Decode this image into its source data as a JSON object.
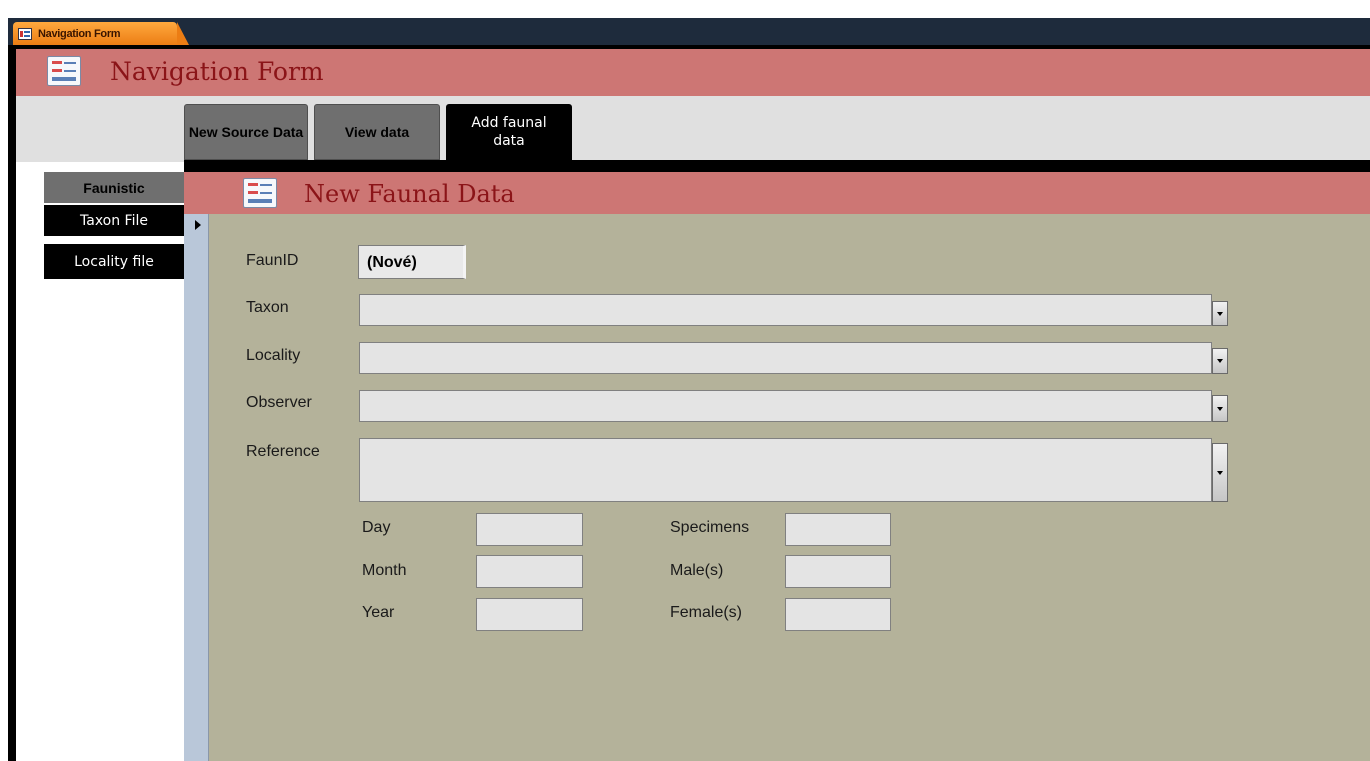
{
  "document_tab": {
    "label": "Navigation Form"
  },
  "header": {
    "title": "Navigation Form"
  },
  "top_tabs": [
    {
      "label": "New Source Data"
    },
    {
      "label": "View data"
    },
    {
      "label": "Add faunal data",
      "active": true
    }
  ],
  "side_nav": [
    {
      "label": "Faunistic",
      "active": true
    },
    {
      "label": "Taxon File"
    },
    {
      "label": "Locality file"
    }
  ],
  "form": {
    "title": "New Faunal Data",
    "faunid_label": "FaunID",
    "faunid_value": "(Nové)",
    "taxon_label": "Taxon",
    "locality_label": "Locality",
    "observer_label": "Observer",
    "reference_label": "Reference",
    "day_label": "Day",
    "month_label": "Month",
    "year_label": "Year",
    "specimens_label": "Specimens",
    "males_label": "Male(s)",
    "females_label": "Female(s)"
  },
  "colors": {
    "header_bg": "#cd7674",
    "title_text": "#8b1418",
    "form_bg": "#b4b29a",
    "tab_active": "#000000",
    "tab_inactive": "#6f6f6f"
  }
}
